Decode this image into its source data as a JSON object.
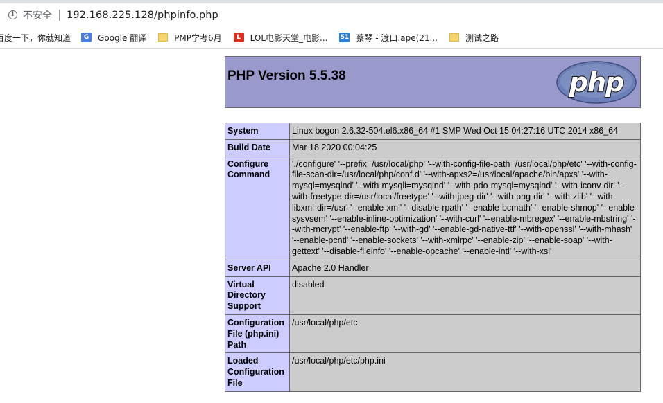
{
  "browser": {
    "security_label": "不安全",
    "url": "192.168.225.128/phpinfo.php",
    "bookmarks": [
      {
        "label": "百度一下，你就知道",
        "icon": "none"
      },
      {
        "label": "Google 翻译",
        "icon": "google-translate-icon"
      },
      {
        "label": "PMP学考6月",
        "icon": "folder-icon"
      },
      {
        "label": "LOL电影天堂_电影...",
        "icon": "lol-icon"
      },
      {
        "label": "蔡琴 - 渡口.ape(21...",
        "icon": "51-icon"
      },
      {
        "label": "测试之路",
        "icon": "folder-icon"
      }
    ]
  },
  "phpinfo": {
    "title": "PHP Version 5.5.38",
    "logo_text": "php",
    "colors": {
      "header_bg": "#9999cc",
      "key_bg": "#ccccff",
      "value_bg": "#cccccc"
    },
    "rows": [
      {
        "key": "System",
        "value": "Linux bogon 2.6.32-504.el6.x86_64 #1 SMP Wed Oct 15 04:27:16 UTC 2014 x86_64"
      },
      {
        "key": "Build Date",
        "value": "Mar 18 2020 00:04:25"
      },
      {
        "key": "Configure Command",
        "value": "'./configure' '--prefix=/usr/local/php' '--with-config-file-path=/usr/local/php/etc' '--with-config-file-scan-dir=/usr/local/php/conf.d' '--with-apxs2=/usr/local/apache/bin/apxs' '--with-mysql=mysqlnd' '--with-mysqli=mysqlnd' '--with-pdo-mysql=mysqlnd' '--with-iconv-dir' '--with-freetype-dir=/usr/local/freetype' '--with-jpeg-dir' '--with-png-dir' '--with-zlib' '--with-libxml-dir=/usr' '--enable-xml' '--disable-rpath' '--enable-bcmath' '--enable-shmop' '--enable-sysvsem' '--enable-inline-optimization' '--with-curl' '--enable-mbregex' '--enable-mbstring' '--with-mcrypt' '--enable-ftp' '--with-gd' '--enable-gd-native-ttf' '--with-openssl' '--with-mhash' '--enable-pcntl' '--enable-sockets' '--with-xmlrpc' '--enable-zip' '--enable-soap' '--with-gettext' '--disable-fileinfo' '--enable-opcache' '--enable-intl' '--with-xsl'"
      },
      {
        "key": "Server API",
        "value": "Apache 2.0 Handler"
      },
      {
        "key": "Virtual Directory Support",
        "value": "disabled"
      },
      {
        "key": "Configuration File (php.ini) Path",
        "value": "/usr/local/php/etc"
      },
      {
        "key": "Loaded Configuration File",
        "value": "/usr/local/php/etc/php.ini"
      }
    ]
  }
}
